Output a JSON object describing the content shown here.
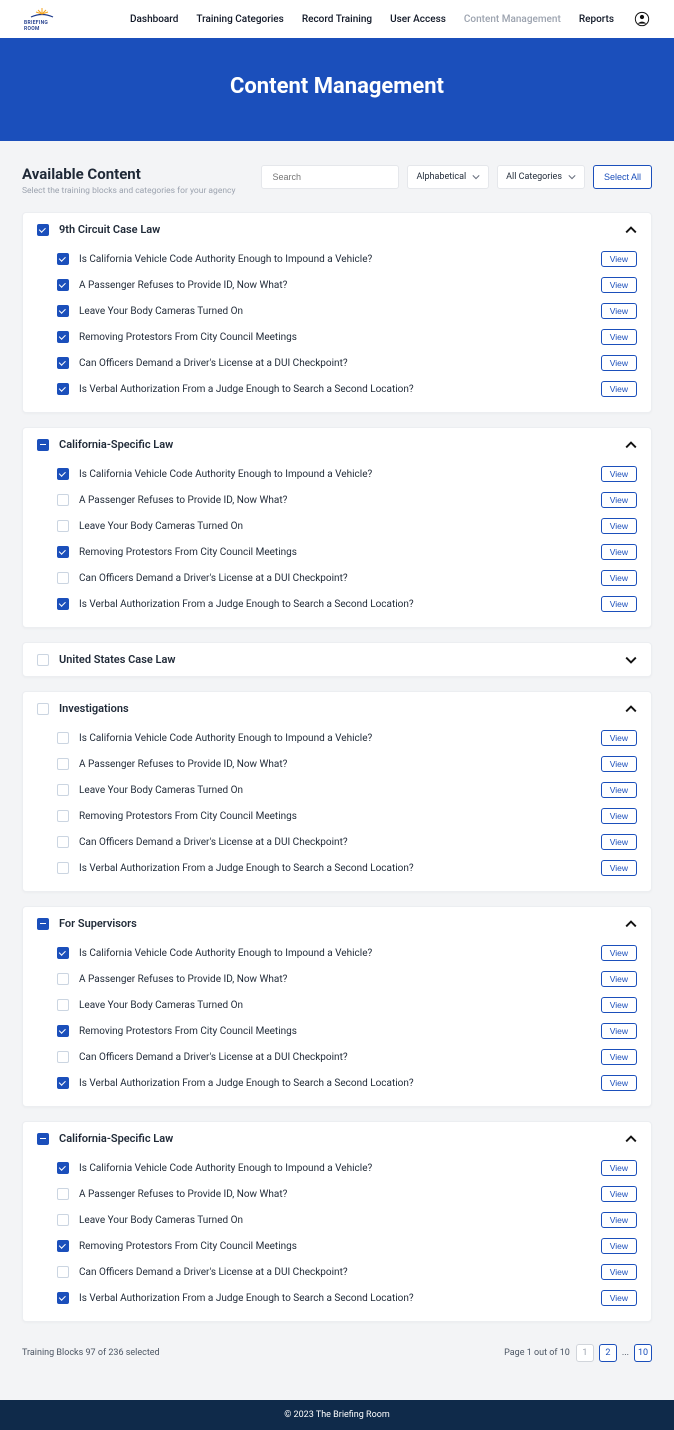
{
  "brand": "BRIEFING ROOM",
  "nav": {
    "items": [
      "Dashboard",
      "Training Categories",
      "Record Training",
      "User Access",
      "Content Management",
      "Reports"
    ],
    "active": "Content Management"
  },
  "hero": {
    "title": "Content Management"
  },
  "page": {
    "title": "Available Content",
    "subtitle": "Select the training blocks and categories for your agency"
  },
  "controls": {
    "search_placeholder": "Search",
    "sort": "Alphabetical",
    "filter": "All Categories",
    "select_all": "Select All"
  },
  "view_label": "View",
  "categories": [
    {
      "title": "9th Circuit Case Law",
      "state": "checked",
      "open": true,
      "items": [
        {
          "label": "Is California Vehicle Code Authority Enough to Impound a Vehicle?",
          "checked": true
        },
        {
          "label": "A Passenger Refuses to Provide ID, Now What?",
          "checked": true
        },
        {
          "label": "Leave Your Body Cameras Turned On",
          "checked": true
        },
        {
          "label": "Removing Protestors From City Council Meetings",
          "checked": true
        },
        {
          "label": "Can Officers Demand a Driver's License at a DUI Checkpoint?",
          "checked": true
        },
        {
          "label": "Is Verbal Authorization From a Judge Enough to Search a Second Location?",
          "checked": true
        }
      ]
    },
    {
      "title": "California-Specific Law",
      "state": "indet",
      "open": true,
      "items": [
        {
          "label": "Is California Vehicle Code Authority Enough to Impound a Vehicle?",
          "checked": true
        },
        {
          "label": "A Passenger Refuses to Provide ID, Now What?",
          "checked": false
        },
        {
          "label": "Leave Your Body Cameras Turned On",
          "checked": false
        },
        {
          "label": "Removing Protestors From City Council Meetings",
          "checked": true
        },
        {
          "label": "Can Officers Demand a Driver's License at a DUI Checkpoint?",
          "checked": false
        },
        {
          "label": "Is Verbal Authorization From a Judge Enough to Search a Second Location?",
          "checked": true
        }
      ]
    },
    {
      "title": "United States Case Law",
      "state": "unchecked",
      "open": false,
      "items": []
    },
    {
      "title": "Investigations",
      "state": "unchecked",
      "open": true,
      "items": [
        {
          "label": "Is California Vehicle Code Authority Enough to Impound a Vehicle?",
          "checked": false
        },
        {
          "label": "A Passenger Refuses to Provide ID, Now What?",
          "checked": false
        },
        {
          "label": "Leave Your Body Cameras Turned On",
          "checked": false
        },
        {
          "label": "Removing Protestors From City Council Meetings",
          "checked": false
        },
        {
          "label": "Can Officers Demand a Driver's License at a DUI Checkpoint?",
          "checked": false
        },
        {
          "label": "Is Verbal Authorization From a Judge Enough to Search a Second Location?",
          "checked": false
        }
      ]
    },
    {
      "title": "For Supervisors",
      "state": "indet",
      "open": true,
      "items": [
        {
          "label": "Is California Vehicle Code Authority Enough to Impound a Vehicle?",
          "checked": true
        },
        {
          "label": "A Passenger Refuses to Provide ID, Now What?",
          "checked": false
        },
        {
          "label": "Leave Your Body Cameras Turned On",
          "checked": false
        },
        {
          "label": "Removing Protestors From City Council Meetings",
          "checked": true
        },
        {
          "label": "Can Officers Demand a Driver's License at a DUI Checkpoint?",
          "checked": false
        },
        {
          "label": "Is Verbal Authorization From a Judge Enough to Search a Second Location?",
          "checked": true
        }
      ]
    },
    {
      "title": "California-Specific Law",
      "state": "indet",
      "open": true,
      "items": [
        {
          "label": "Is California Vehicle Code Authority Enough to Impound a Vehicle?",
          "checked": true
        },
        {
          "label": "A Passenger Refuses to Provide ID, Now What?",
          "checked": false
        },
        {
          "label": "Leave Your Body Cameras Turned On",
          "checked": false
        },
        {
          "label": "Removing Protestors From City Council Meetings",
          "checked": true
        },
        {
          "label": "Can Officers Demand a Driver's License at a DUI Checkpoint?",
          "checked": false
        },
        {
          "label": "Is Verbal Authorization From a Judge Enough to Search a Second Location?",
          "checked": true
        }
      ]
    }
  ],
  "footer": {
    "summary": "Training Blocks 97 of 236 selected",
    "page_info": "Page 1 out of 10",
    "pages": [
      "1",
      "2",
      "...",
      "10"
    ]
  },
  "copyright": "© 2023 The Briefing Room"
}
